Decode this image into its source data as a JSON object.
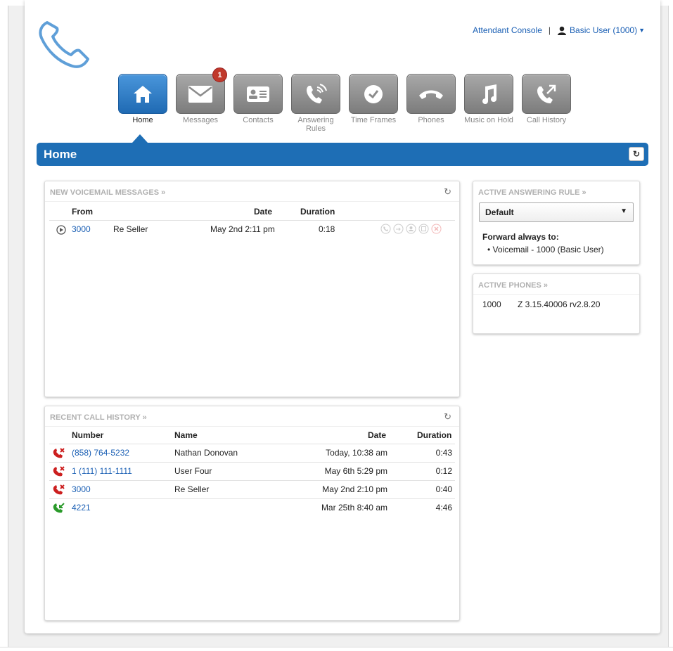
{
  "header": {
    "attendant_console": "Attendant Console",
    "separator": "|",
    "user_menu": "Basic User (1000)"
  },
  "nav": [
    {
      "label": "Home",
      "icon": "home-icon",
      "active": true
    },
    {
      "label": "Messages",
      "icon": "envelope-icon",
      "badge": "1"
    },
    {
      "label": "Contacts",
      "icon": "contact-card-icon"
    },
    {
      "label": "Answering Rules",
      "icon": "phone-rules-icon"
    },
    {
      "label": "Time Frames",
      "icon": "clock-icon"
    },
    {
      "label": "Phones",
      "icon": "handset-icon"
    },
    {
      "label": "Music on Hold",
      "icon": "music-note-icon"
    },
    {
      "label": "Call History",
      "icon": "call-history-icon"
    }
  ],
  "page_title": "Home",
  "voicemail": {
    "title": "NEW VOICEMAIL MESSAGES »",
    "headers": {
      "from": "From",
      "date": "Date",
      "duration": "Duration"
    },
    "rows": [
      {
        "from_number": "3000",
        "from_name": "Re Seller",
        "date": "May 2nd 2:11 pm",
        "duration": "0:18"
      }
    ]
  },
  "call_history": {
    "title": "RECENT CALL HISTORY »",
    "headers": {
      "number": "Number",
      "name": "Name",
      "date": "Date",
      "duration": "Duration"
    },
    "rows": [
      {
        "type": "missed",
        "number": "(858) 764-5232",
        "name": "Nathan Donovan",
        "date": "Today, 10:38 am",
        "duration": "0:43"
      },
      {
        "type": "missed",
        "number": "1 (111) 111-1111",
        "name": "User Four",
        "date": "May 6th 5:29 pm",
        "duration": "0:12"
      },
      {
        "type": "missed",
        "number": "3000",
        "name": "Re Seller",
        "date": "May 2nd 2:10 pm",
        "duration": "0:40"
      },
      {
        "type": "incoming",
        "number": "4221",
        "name": "",
        "date": "Mar 25th 8:40 am",
        "duration": "4:46"
      }
    ]
  },
  "answering_rule": {
    "title": "ACTIVE ANSWERING RULE »",
    "selected": "Default",
    "forward_label": "Forward always to:",
    "forward_item": "Voicemail - 1000 (Basic User)"
  },
  "active_phones": {
    "title": "ACTIVE PHONES »",
    "rows": [
      {
        "ext": "1000",
        "model": "Z 3.15.40006 rv2.8.20"
      }
    ]
  },
  "colors": {
    "brand_blue": "#1e6eb5",
    "link": "#1a5fb4",
    "missed": "#cc1f1f",
    "incoming": "#2a9a2a",
    "badge": "#c0392b"
  }
}
